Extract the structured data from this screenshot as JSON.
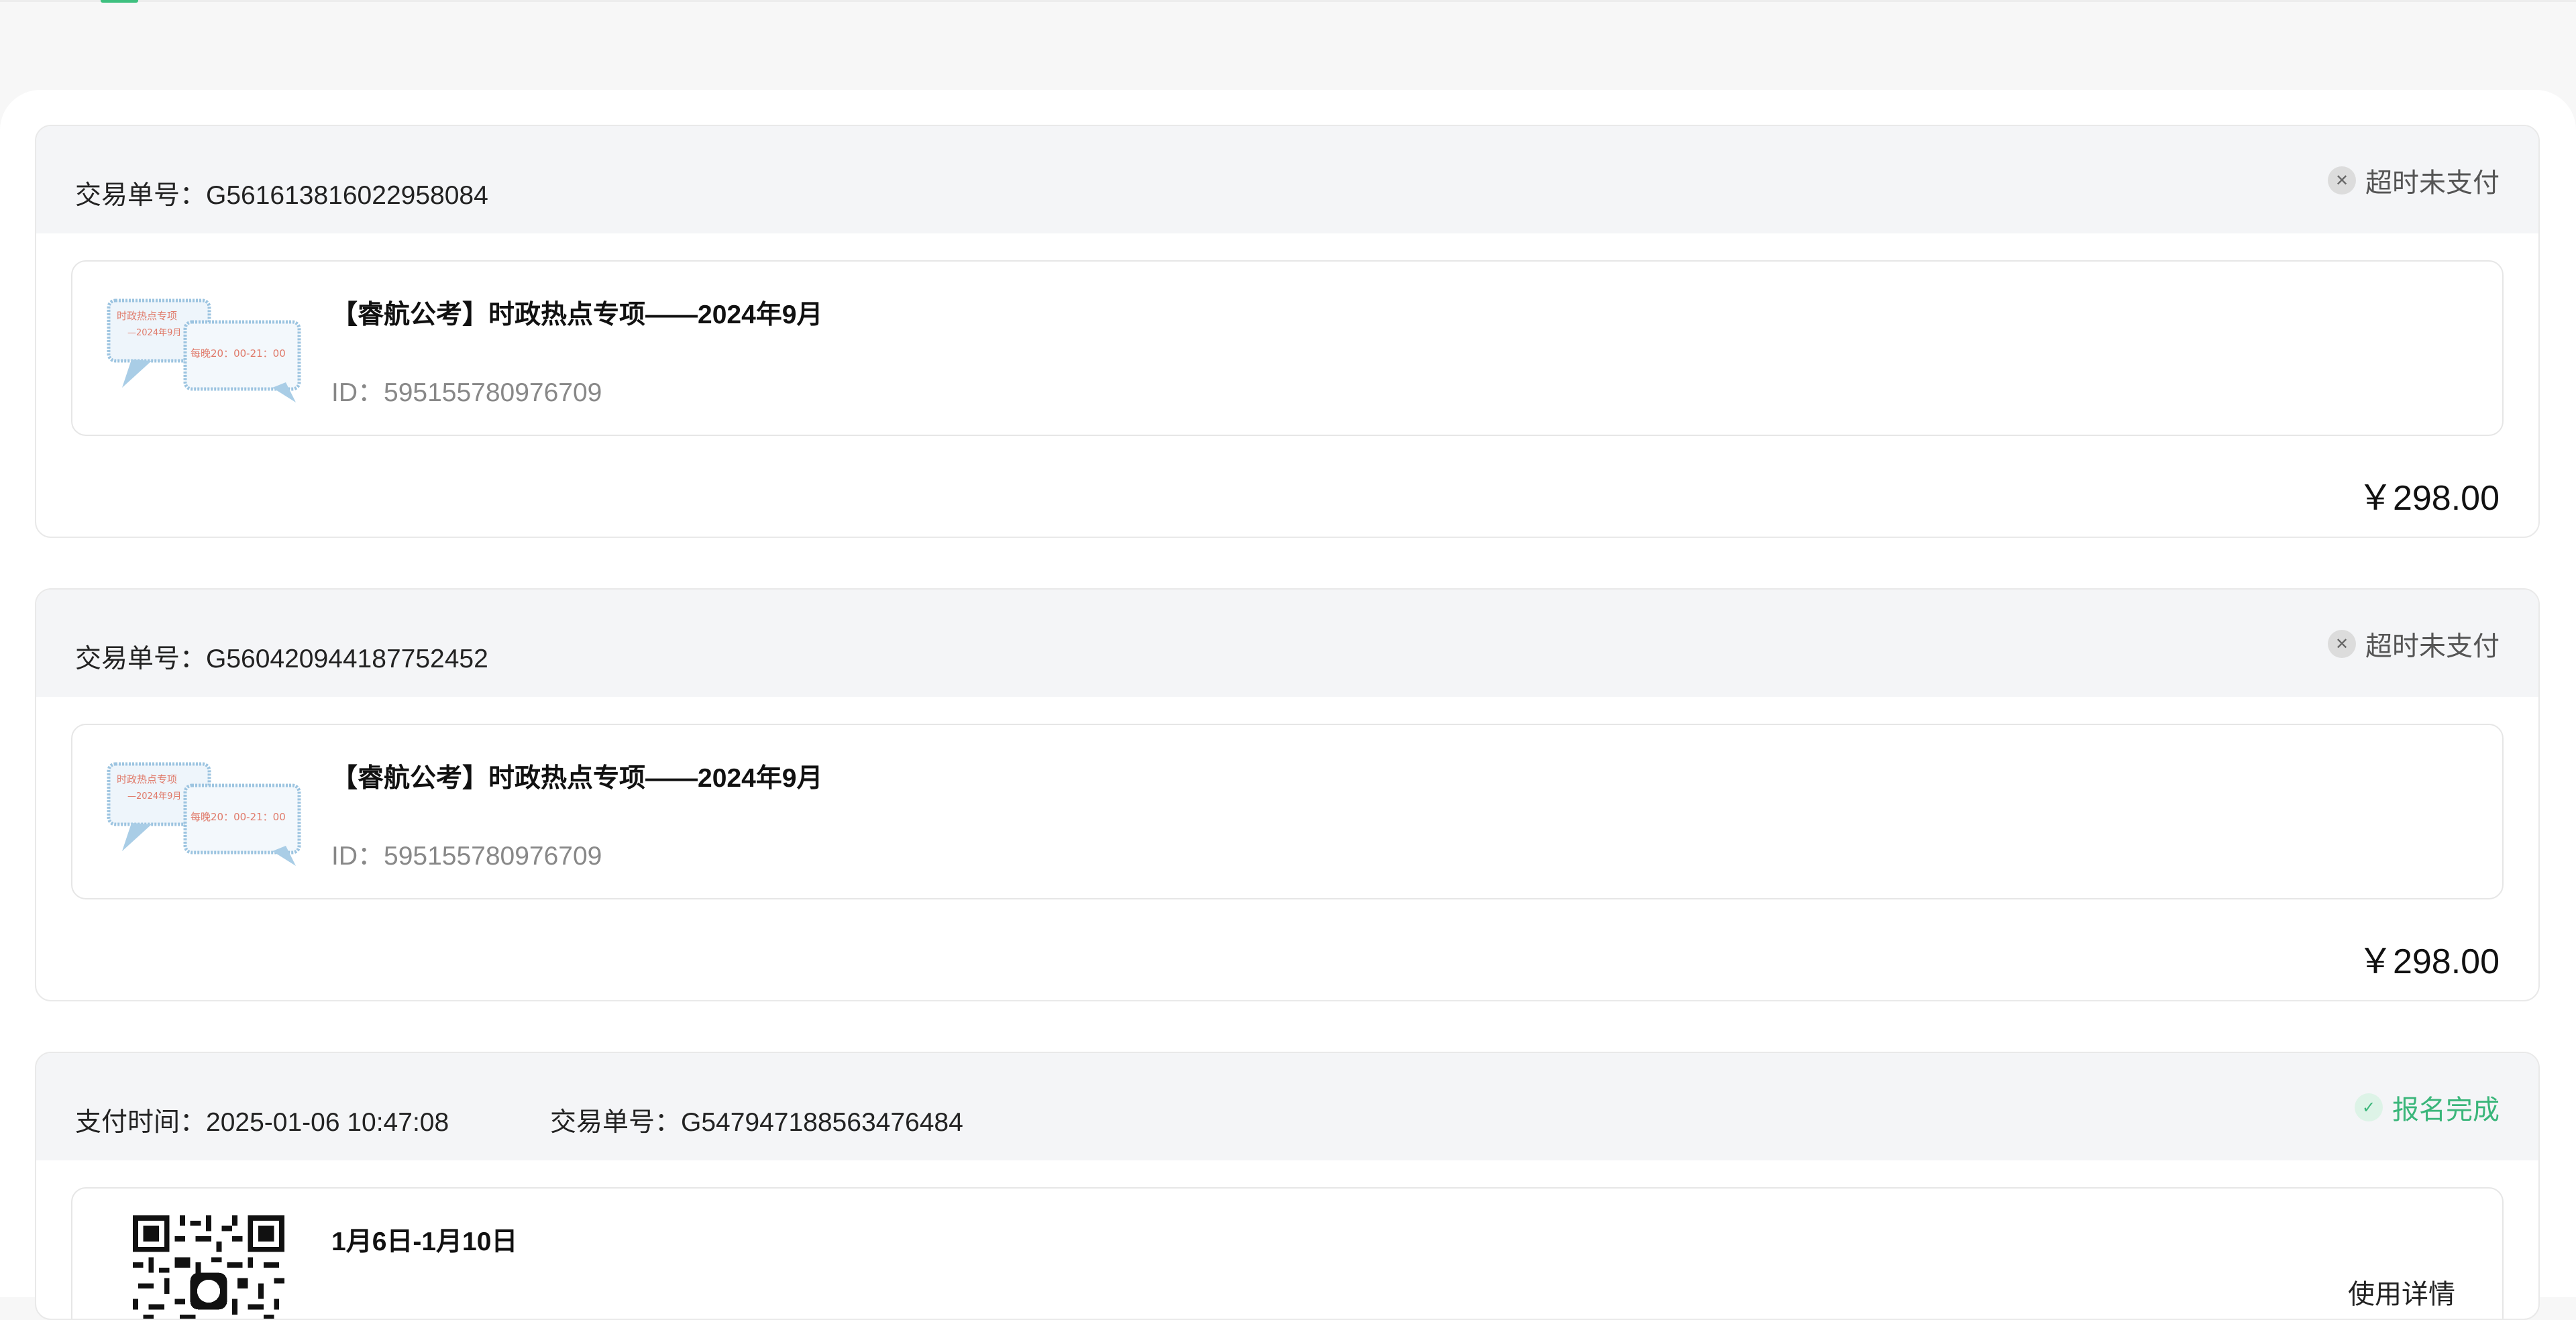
{
  "orders": [
    {
      "order_label": "交易单号：",
      "order_no": "G561613816022958084",
      "status": "超时未支付",
      "status_icon": "close-icon",
      "item": {
        "title": "【睿航公考】时政热点专项——2024年9月",
        "id_label": "ID：",
        "id": "595155780976709",
        "thumb_text_1": "时政热点专项",
        "thumb_text_2": "—2024年9月",
        "thumb_text_3": "每晚20：00-21：00"
      },
      "price": "￥298.00"
    },
    {
      "order_label": "交易单号：",
      "order_no": "G560420944187752452",
      "status": "超时未支付",
      "status_icon": "close-icon",
      "item": {
        "title": "【睿航公考】时政热点专项——2024年9月",
        "id_label": "ID：",
        "id": "595155780976709",
        "thumb_text_1": "时政热点专项",
        "thumb_text_2": "—2024年9月",
        "thumb_text_3": "每晚20：00-21：00"
      },
      "price": "￥298.00"
    },
    {
      "pay_time_label": "支付时间：",
      "pay_time": "2025-01-06 10:47:08",
      "order_label": "交易单号：",
      "order_no": "G547947188563476484",
      "status": "报名完成",
      "status_icon": "check-icon",
      "item": {
        "title": "1月6日-1月10日",
        "detail_link": "使用详情"
      }
    }
  ],
  "colors": {
    "accent_green": "#3ab67a",
    "status_gray": "#555555",
    "header_bg": "#f4f5f7"
  }
}
